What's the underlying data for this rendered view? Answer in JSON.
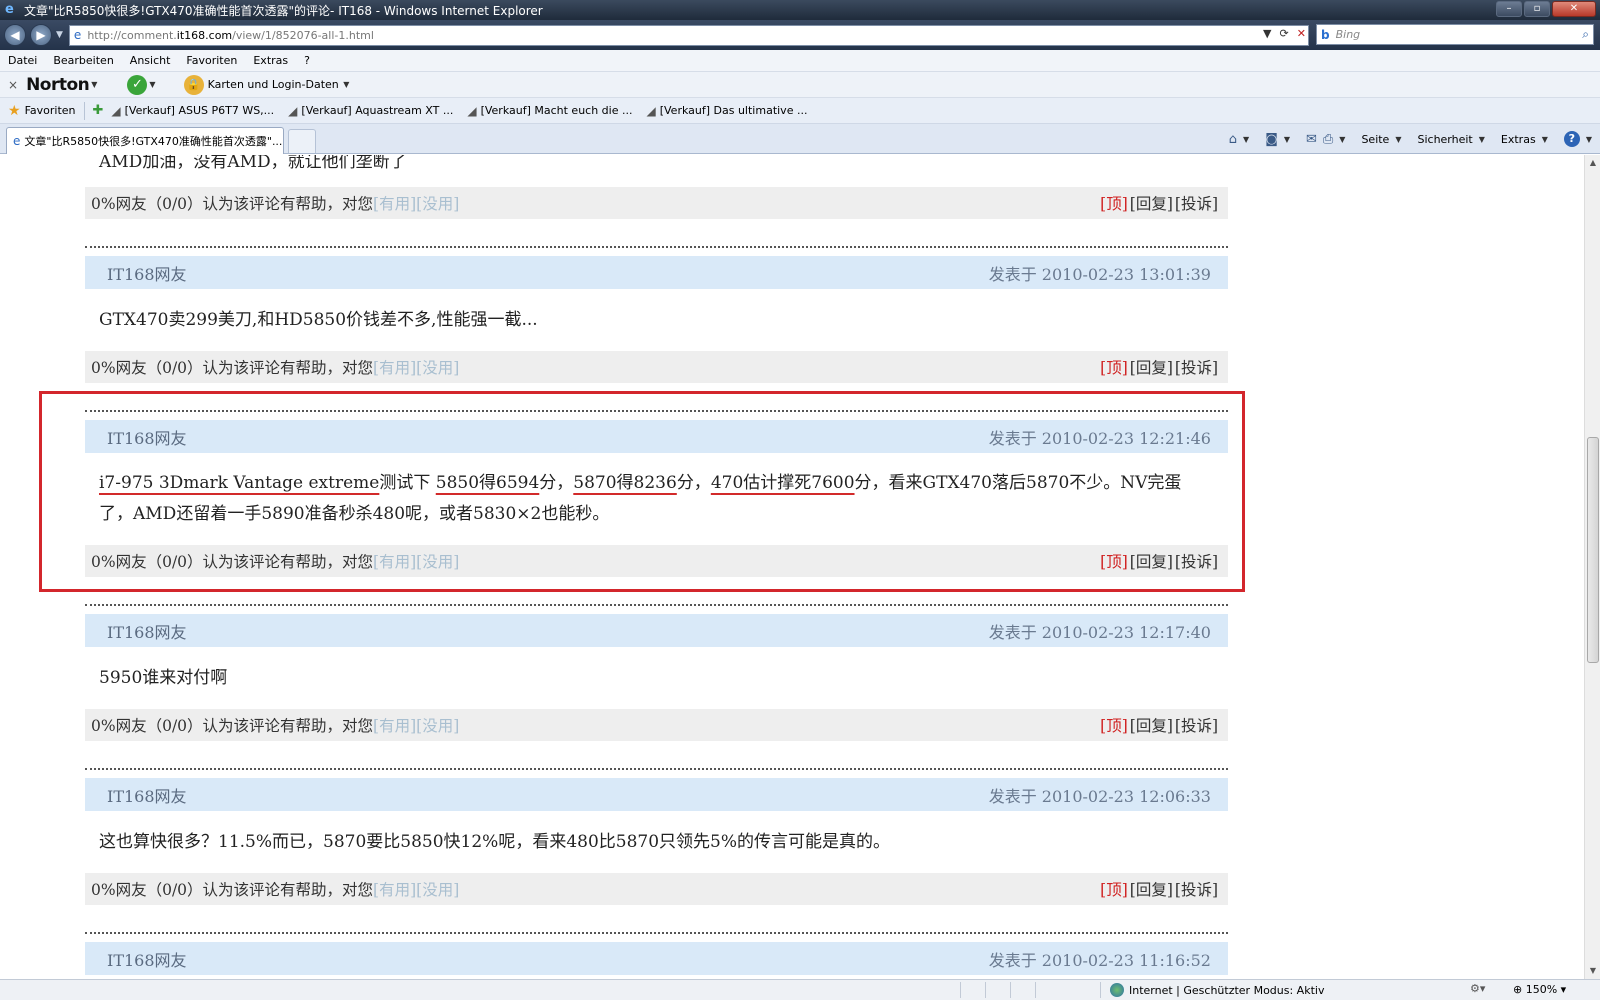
{
  "window": {
    "title": "文章\"比R5850快很多!GTX470准确性能首次透露\"的评论- IT168 - Windows Internet Explorer",
    "min": "–",
    "max": "▫",
    "close": "✕"
  },
  "address": {
    "url_prefix": "http://comment.",
    "url_domain": "it168.com",
    "url_path": "/view/1/852076-all-1.html",
    "search_placeholder": "Bing"
  },
  "menu": [
    "Datei",
    "Bearbeiten",
    "Ansicht",
    "Favoriten",
    "Extras",
    "?"
  ],
  "norton": {
    "logo": "Norton",
    "identity_label": "Karten und Login-Daten"
  },
  "favorites": {
    "label": "Favoriten",
    "items": [
      "[Verkauf] ASUS P6T7 WS,...",
      "[Verkauf] Aquastream XT ...",
      "[Verkauf] Macht euch die ...",
      "[Verkauf] Das ultimative ..."
    ]
  },
  "tab": {
    "title": "文章\"比R5850快很多!GTX470准确性能首次透露\"..."
  },
  "commandbar": {
    "page": "Seite",
    "safety": "Sicherheit",
    "tools": "Extras"
  },
  "footer_labels": {
    "helpful": "0%网友（0/0）认为该评论有帮助，对您",
    "useful": "[有用]",
    "useless": "[没用]",
    "top": "[顶]",
    "reply": "[回复]",
    "report": "[投诉]"
  },
  "comments": [
    {
      "author": "",
      "date": "",
      "text": "AMD加油，没有AMD，就让他们垄断了"
    },
    {
      "author": "IT168网友",
      "date": "发表于 2010-02-23 13:01:39",
      "text": "GTX470卖299美刀,和HD5850价钱差不多,性能强一截..."
    },
    {
      "author": "IT168网友",
      "date": "发表于 2010-02-23 12:21:46",
      "text_parts": [
        {
          "t": "i7-975 3Dmark Vantage extreme",
          "u": true
        },
        {
          "t": "测试下 ",
          "u": false
        },
        {
          "t": "5850得6594",
          "u": true
        },
        {
          "t": "分，",
          "u": false
        },
        {
          "t": "5870得8236",
          "u": true
        },
        {
          "t": "分，",
          "u": false
        },
        {
          "t": "470估计撑死7600",
          "u": true
        },
        {
          "t": "分，看来GTX470落后5870不少。NV完蛋了，AMD还留着一手5890准备秒杀480呢，或者5830×2也能秒。",
          "u": false
        }
      ]
    },
    {
      "author": "IT168网友",
      "date": "发表于 2010-02-23 12:17:40",
      "text": "5950谁来对付啊"
    },
    {
      "author": "IT168网友",
      "date": "发表于 2010-02-23 12:06:33",
      "text": "这也算快很多？11.5%而已，5870要比5850快12%呢，看来480比5870只领先5%的传言可能是真的。"
    },
    {
      "author": "IT168网友",
      "date": "发表于 2010-02-23 11:16:52",
      "text": ""
    }
  ],
  "status": {
    "zone": "Internet | Geschützter Modus: Aktiv",
    "zoom": "150%"
  },
  "colors": {
    "highlight": "#d3262c",
    "header_bg": "#d9e9f8",
    "top_link": "#d02020"
  }
}
